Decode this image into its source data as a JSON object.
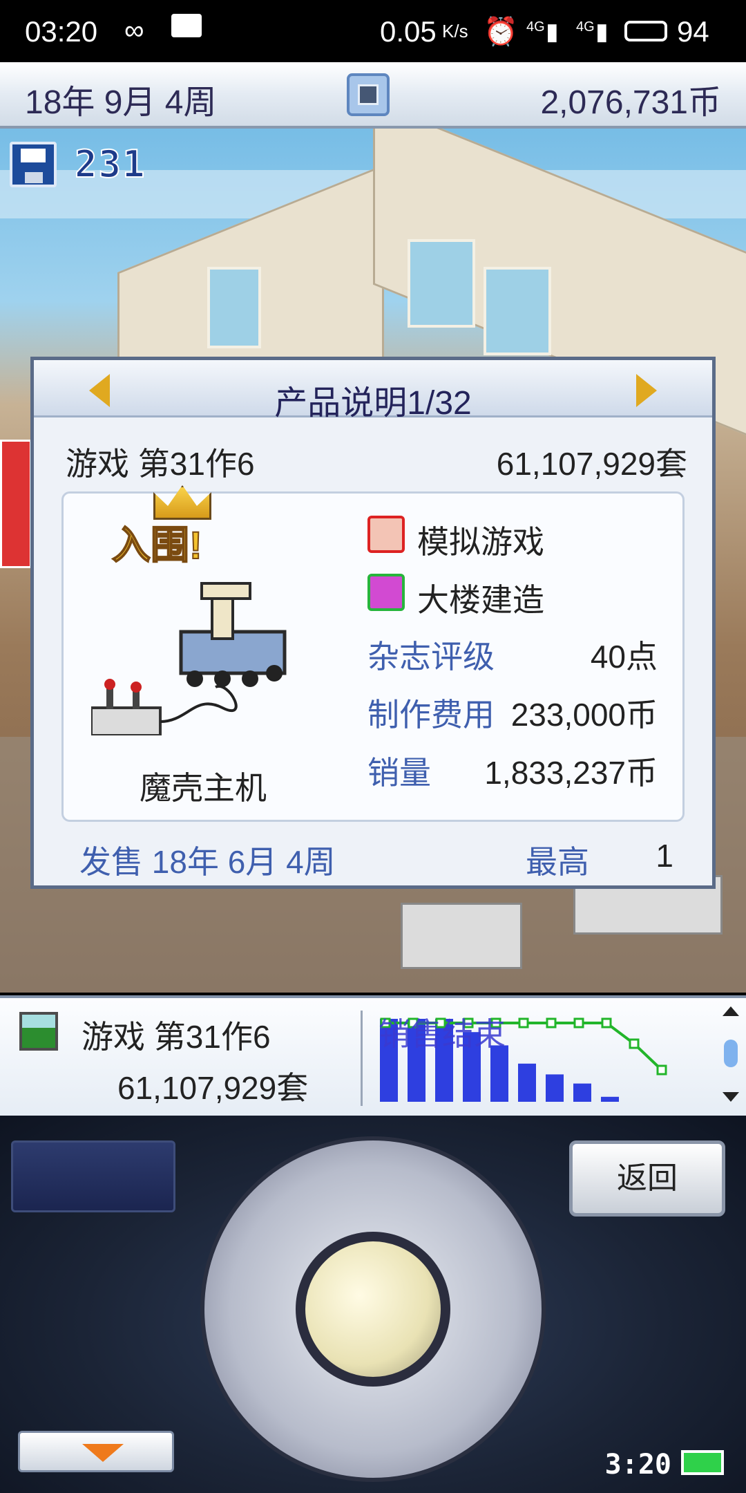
{
  "status_bar": {
    "time": "03:20",
    "net_speed": "0.05",
    "net_unit": "K/s",
    "signal1": "4G",
    "signal2": "4G",
    "battery": "94"
  },
  "topbar": {
    "date": "18年 9月 4周",
    "money": "2,076,731币"
  },
  "save_count": "231",
  "dialog": {
    "title": "产品说明1/32",
    "game_name": "游戏 第31作6",
    "sales_units": "61,107,929套",
    "award_label": "入围!",
    "platform": "魔壳主机",
    "genre": "模拟游戏",
    "theme": "大楼建造",
    "magazine_label": "杂志评级",
    "magazine_value": "40点",
    "cost_label": "制作费用",
    "cost_value": "233,000币",
    "sales_label": "销量",
    "sales_value": "1,833,237币",
    "release": "发售 18年 6月 4周",
    "best_label": "最高",
    "best_value": "1"
  },
  "strip": {
    "game_name": "游戏 第31作6",
    "units": "61,107,929套",
    "chart_overlay": "销售结束"
  },
  "chart_data": {
    "type": "bar",
    "series": [
      {
        "name": "bars",
        "values": [
          100,
          100,
          100,
          84,
          68,
          46,
          33,
          22,
          6
        ]
      },
      {
        "name": "line",
        "values": [
          100,
          100,
          100,
          100,
          100,
          100,
          100,
          100,
          100,
          70,
          32
        ]
      }
    ]
  },
  "controller": {
    "back_label": "返回",
    "clock": "3:20"
  },
  "colors": {
    "accent": "#3f5fae",
    "title": "#23235a",
    "chart_bar": "#2e3fe0",
    "chart_line": "#22b52a"
  }
}
